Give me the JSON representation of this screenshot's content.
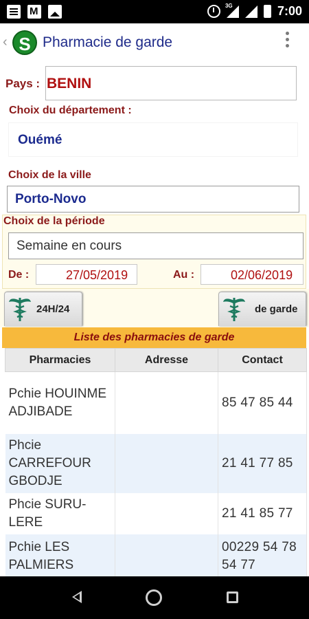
{
  "status_bar": {
    "time": "7:00",
    "network": "3G"
  },
  "app_bar": {
    "logo_letter": "S",
    "title": "Pharmacie de garde"
  },
  "form": {
    "pays_label": "Pays :",
    "pays_value": "BENIN",
    "departement_label": "Choix du département :",
    "departement_value": "Ouémé",
    "ville_label": "Choix de la ville",
    "ville_value": "Porto-Novo",
    "periode_label": "Choix de la période",
    "periode_value": "Semaine en cours",
    "de_label": "De :",
    "de_value": "27/05/2019",
    "au_label": "Au :",
    "au_value": "02/06/2019"
  },
  "tabs": [
    {
      "label": "24H/24",
      "icon": "caduceus-icon"
    },
    {
      "label": "de garde",
      "icon": "caduceus-icon"
    }
  ],
  "list": {
    "header": "Liste des pharmacies de garde",
    "columns": [
      "Pharmacies",
      "Adresse",
      "Contact"
    ],
    "rows": [
      {
        "pharmacie": "Pchie HOUINME ADJIBADE",
        "adresse": "",
        "contact": "85 47 85 44"
      },
      {
        "pharmacie": "Phcie CARREFOUR GBODJE",
        "adresse": "",
        "contact": "21 41 77 85"
      },
      {
        "pharmacie": "Phcie SURU-LERE",
        "adresse": "",
        "contact": "21 41 85 77"
      },
      {
        "pharmacie": "Pchie LES PALMIERS",
        "adresse": "",
        "contact": "00229 54 78 54 77"
      }
    ]
  },
  "colors": {
    "title_blue": "#1f2b8a",
    "label_red": "#8b1a1a",
    "value_red": "#b01010",
    "header_orange": "#f7b93c",
    "row_alt_blue": "#eaf2fb",
    "logo_green": "#1b8a2b"
  }
}
